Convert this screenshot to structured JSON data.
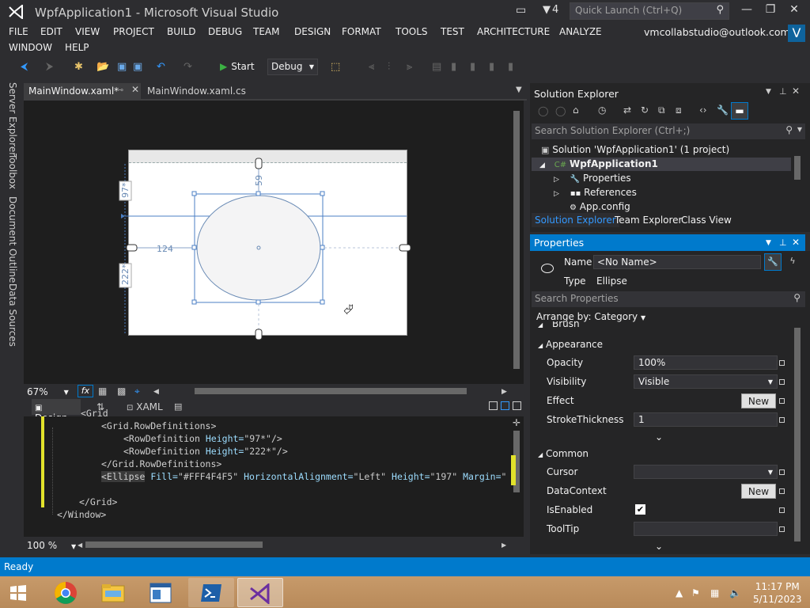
{
  "window": {
    "title": "WpfApplication1 - Microsoft Visual Studio",
    "notification_count": "4"
  },
  "quick_launch": {
    "placeholder": "Quick Launch (Ctrl+Q)"
  },
  "menu": {
    "row1": [
      "FILE",
      "EDIT",
      "VIEW",
      "PROJECT",
      "BUILD",
      "DEBUG",
      "TEAM",
      "DESIGN",
      "FORMAT",
      "TOOLS",
      "TEST",
      "ARCHITECTURE",
      "ANALYZE"
    ],
    "row2": [
      "WINDOW",
      "HELP"
    ]
  },
  "account": {
    "email": "vmcollabstudio@outlook.com",
    "avatar_letter": "V"
  },
  "toolbar": {
    "start_label": "Start",
    "config": "Debug"
  },
  "left_tabs": [
    "Server Explorer",
    "Toolbox",
    "Document Outline",
    "Data Sources"
  ],
  "doc_tabs": {
    "active": "MainWindow.xaml*",
    "other": "MainWindow.xaml.cs"
  },
  "designer": {
    "top_margin": "59",
    "left_margin": "124",
    "row1_height": "97*",
    "row2_height": "222*"
  },
  "zoom": {
    "designer": "67%",
    "code": "100 %"
  },
  "split_tabs": {
    "design": "Design",
    "xaml": "XAML"
  },
  "code": {
    "line0": "<Grid",
    "line1_tag": "<Grid.RowDefinitions>",
    "line2_tag": "<RowDefinition",
    "line2_attr": "Height=",
    "line2_val": "\"97*\"",
    "line2_end": "/>",
    "line3_tag": "<RowDefinition",
    "line3_attr": "Height=",
    "line3_val": "\"222*\"",
    "line3_end": "/>",
    "line4_tag": "</Grid.RowDefinitions>",
    "line5_tag": "<Ellipse",
    "line5_attr1": "Fill=",
    "line5_val1": "\"#FFF4F4F5\"",
    "line5_attr2": "HorizontalAlignment=",
    "line5_val2": "\"Left\"",
    "line5_attr3": "Height=",
    "line5_val3": "\"197\"",
    "line5_attr4": "Margin=",
    "line5_val4": "\"",
    "line6_tag": "</Grid>",
    "line7_tag": "</Window>"
  },
  "solution_explorer": {
    "title": "Solution Explorer",
    "search_placeholder": "Search Solution Explorer (Ctrl+;)",
    "solution": "Solution 'WpfApplication1' (1 project)",
    "project": "WpfApplication1",
    "items": [
      "Properties",
      "References",
      "App.config"
    ],
    "bottom_tabs": [
      "Solution Explorer",
      "Team Explorer",
      "Class View"
    ]
  },
  "properties": {
    "title": "Properties",
    "name_label": "Name",
    "name_value": "<No Name>",
    "type_label": "Type",
    "type_value": "Ellipse",
    "search_placeholder": "Search Properties",
    "arrange_by": "Arrange by: Category",
    "partial_category": "Brush",
    "appearance": "Appearance",
    "opacity_label": "Opacity",
    "opacity_value": "100%",
    "visibility_label": "Visibility",
    "visibility_value": "Visible",
    "effect_label": "Effect",
    "new_label": "New",
    "stroke_label": "StrokeThickness",
    "stroke_value": "1",
    "common": "Common",
    "cursor_label": "Cursor",
    "datacontext_label": "DataContext",
    "isenabled_label": "IsEnabled",
    "tooltip_label": "ToolTip"
  },
  "status": {
    "text": "Ready"
  },
  "taskbar": {
    "time": "11:17 PM",
    "date": "5/11/2023"
  },
  "colors": {
    "accent": "#007acc",
    "background": "#2d2d30",
    "editor_bg": "#1e1e1e",
    "change_marker": "#e2e22b"
  }
}
